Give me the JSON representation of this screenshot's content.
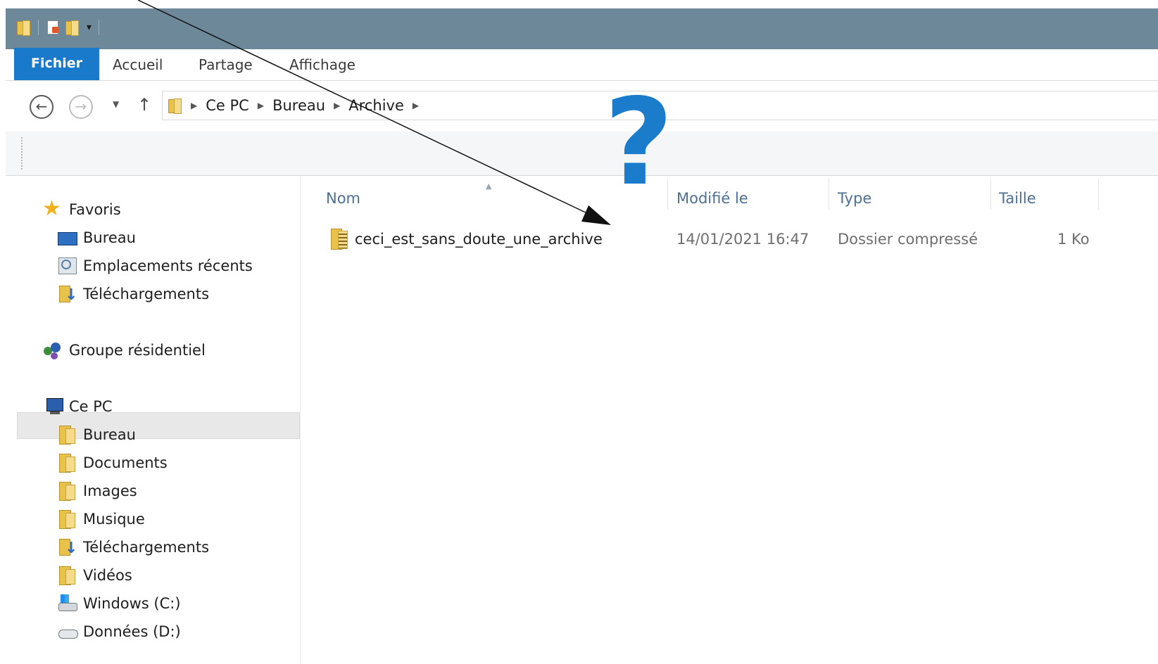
{
  "ribbon": {
    "tabs": [
      {
        "label": "Fichier"
      },
      {
        "label": "Accueil"
      },
      {
        "label": "Partage"
      },
      {
        "label": "Affichage"
      }
    ]
  },
  "address": {
    "crumbs": [
      "Ce PC",
      "Bureau",
      "Archive"
    ]
  },
  "nav": {
    "favorites_label": "Favoris",
    "favorites": [
      "Bureau",
      "Emplacements récents",
      "Téléchargements"
    ],
    "homegroup_label": "Groupe résidentiel",
    "pc_label": "Ce PC",
    "pc_items": [
      "Bureau",
      "Documents",
      "Images",
      "Musique",
      "Téléchargements",
      "Vidéos",
      "Windows (C:)",
      "Données (D:)"
    ]
  },
  "columns": {
    "name": "Nom",
    "modified": "Modifié le",
    "type": "Type",
    "size": "Taille"
  },
  "files": [
    {
      "name": "ceci_est_sans_doute_une_archive",
      "modified": "14/01/2021 16:47",
      "type": "Dossier compressé",
      "size": "1 Ko"
    }
  ],
  "annotation": {
    "symbol": "?",
    "color": "#1b7ccc"
  }
}
